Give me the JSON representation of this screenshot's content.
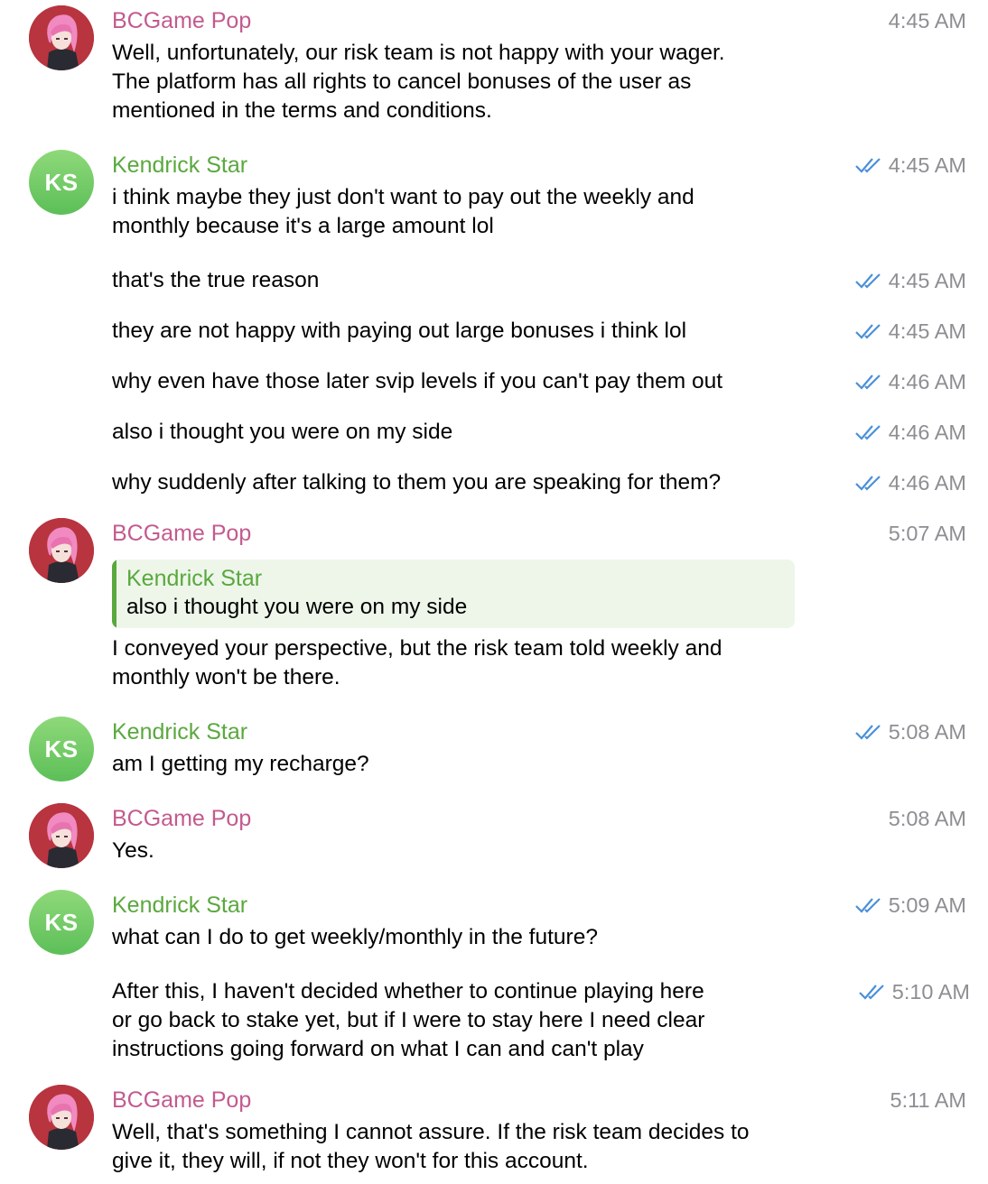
{
  "colors": {
    "pop_name": "#c35a8f",
    "ks_name": "#5aa83e",
    "time": "#8e8e93",
    "check": "#4a90d9",
    "reply_bg": "#eef6ea",
    "ks_avatar": "#6cc865",
    "pop_avatar_bg": "#b8343f"
  },
  "users": {
    "pop": {
      "name": "BCGame Pop",
      "avatar": "anime-character-avatar"
    },
    "ks": {
      "name": "Kendrick Star",
      "initials": "KS"
    }
  },
  "messages": [
    {
      "sender": "BCGame Pop",
      "time": "4:45 AM",
      "lines": [
        "Well, unfortunately, our risk team is not happy with your wager.",
        "The platform has all rights to cancel bonuses of the user as",
        "mentioned in the terms and conditions."
      ]
    },
    {
      "sender": "Kendrick Star",
      "time": "4:45 AM",
      "lines": [
        "i think maybe they just don't want to pay out the weekly and",
        "monthly because it's a large amount lol"
      ]
    },
    {
      "time": "4:45 AM",
      "lines": [
        "that's the true reason"
      ]
    },
    {
      "time": "4:45 AM",
      "lines": [
        "they are not happy with paying out large bonuses i think lol"
      ]
    },
    {
      "time": "4:46 AM",
      "lines": [
        "why even have those later svip levels if you can't pay them out"
      ]
    },
    {
      "time": "4:46 AM",
      "lines": [
        "also i thought you were on my side"
      ]
    },
    {
      "time": "4:46 AM",
      "lines": [
        "why suddenly after talking to them you are speaking for them?"
      ]
    },
    {
      "sender": "BCGame Pop",
      "time": "5:07 AM",
      "reply": {
        "name": "Kendrick Star",
        "text": "also i thought you were on my side"
      },
      "lines": [
        "I conveyed your perspective, but the risk team told weekly and",
        "monthly won't be there."
      ]
    },
    {
      "sender": "Kendrick Star",
      "time": "5:08 AM",
      "lines": [
        "am I getting my recharge?"
      ]
    },
    {
      "sender": "BCGame Pop",
      "time": "5:08 AM",
      "lines": [
        "Yes."
      ]
    },
    {
      "sender": "Kendrick Star",
      "time": "5:09 AM",
      "lines": [
        "what can I do to get weekly/monthly in the future?"
      ]
    },
    {
      "time": "5:10 AM",
      "lines": [
        "After this, I haven't decided whether to continue playing here",
        "or go back to stake yet, but if I were to stay here I need clear",
        "instructions going forward on what I can and can't play"
      ]
    },
    {
      "sender": "BCGame Pop",
      "time": "5:11 AM",
      "lines": [
        "Well, that's something I cannot assure. If the risk team decides to",
        "give it, they will, if not they won't for this account."
      ]
    }
  ]
}
